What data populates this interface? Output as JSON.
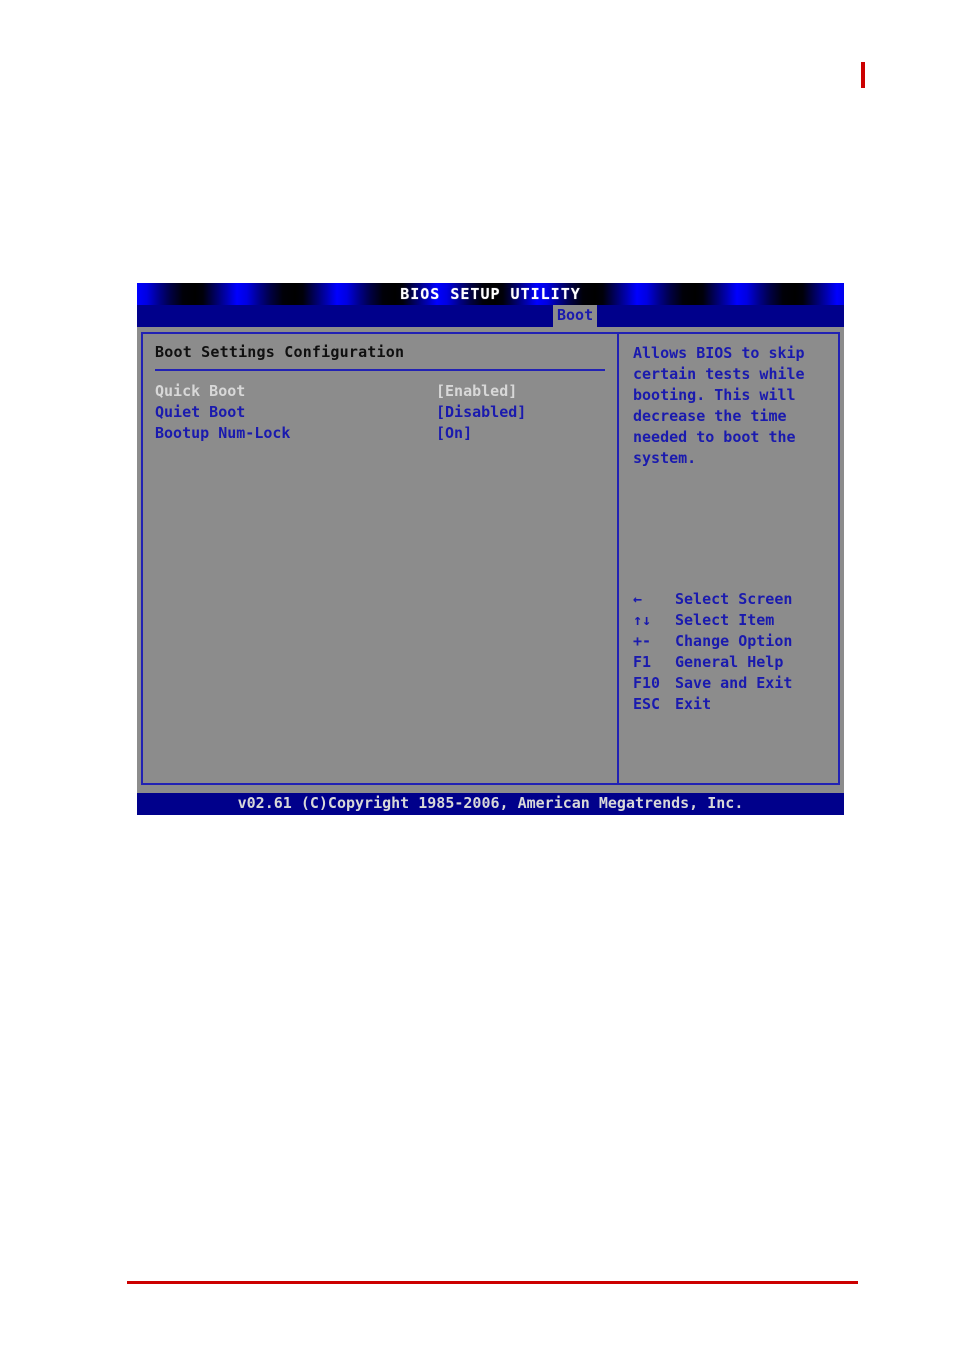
{
  "page": {
    "top_mark_color": "#cc0000",
    "bottom_rule_color": "#cc0000"
  },
  "bios": {
    "title": "BIOS SETUP UTILITY",
    "active_tab": "Boot",
    "tabs": [
      "Boot"
    ],
    "section_title": "Boot Settings Configuration",
    "settings": [
      {
        "label": "Quick Boot",
        "value": "[Enabled]",
        "selected": true
      },
      {
        "label": "Quiet Boot",
        "value": "[Disabled]",
        "selected": false
      },
      {
        "label": "Bootup Num-Lock",
        "value": "[On]",
        "selected": false
      }
    ],
    "help": {
      "lines": [
        "Allows BIOS to skip",
        "certain tests while",
        "booting. This will",
        "decrease the time",
        "needed to boot the",
        "system."
      ]
    },
    "keys": [
      {
        "key": "←",
        "desc": "Select Screen"
      },
      {
        "key": "↑↓",
        "desc": "Select Item"
      },
      {
        "key": "+-",
        "desc": "Change Option"
      },
      {
        "key": "F1",
        "desc": "General Help"
      },
      {
        "key": "F10",
        "desc": "Save and Exit"
      },
      {
        "key": "ESC",
        "desc": "Exit"
      }
    ],
    "footer": "v02.61 (C)Copyright 1985-2006, American Megatrends, Inc.",
    "colors": {
      "screen_bg": "#8c8c8c",
      "accent_blue": "#1a1aae",
      "bar_blue": "#00008b",
      "selected_text": "#d8d8d8"
    }
  }
}
